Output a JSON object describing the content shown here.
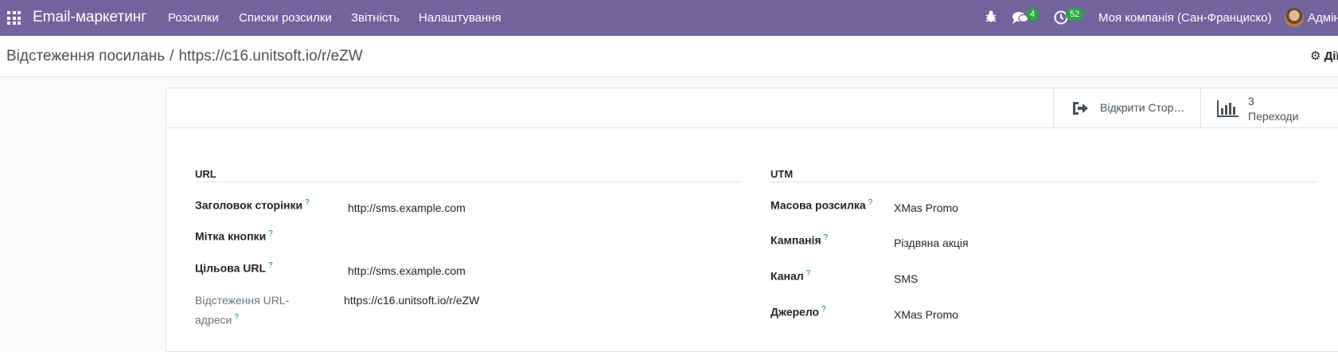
{
  "navbar": {
    "brand": "Email-маркетинг",
    "menu": [
      "Розсилки",
      "Списки розсилки",
      "Звітність",
      "Налаштування"
    ],
    "messages_count": "4",
    "activities_count": "52",
    "company": "Моя компанія (Сан-Франциско)",
    "user": "Адмін"
  },
  "breadcrumb": {
    "parent": "Відстеження посилань",
    "separator": "/",
    "current": "https://c16.unitsoft.io/r/eZW"
  },
  "control": {
    "actions_label": "Дії"
  },
  "buttons": {
    "open_page": "Відкрити Стор…",
    "clicks_count": "3",
    "clicks_label": "Переходи"
  },
  "url_section": {
    "title": "URL",
    "fields": [
      {
        "label": "Заголовок сторінки",
        "value": "http://sms.example.com"
      },
      {
        "label": "Мітка кнопки",
        "value": ""
      },
      {
        "label": "Цільова URL",
        "value": "http://sms.example.com"
      },
      {
        "label": "Відстеження URL-адреси",
        "value": "https://c16.unitsoft.io/r/eZW"
      }
    ]
  },
  "utm_section": {
    "title": "UTM",
    "fields": [
      {
        "label": "Масова розсилка",
        "value": "XMas Promo"
      },
      {
        "label": "Кампанія",
        "value": "Різдвяна акція"
      },
      {
        "label": "Канал",
        "value": "SMS"
      },
      {
        "label": "Джерело",
        "value": "XMas Promo"
      }
    ]
  },
  "help_marker": "?"
}
